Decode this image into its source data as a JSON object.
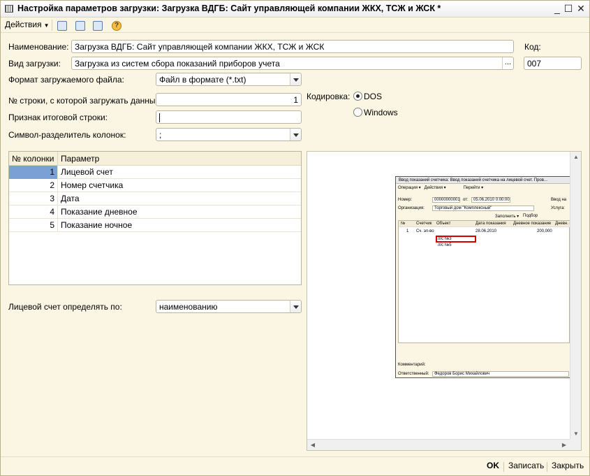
{
  "window": {
    "title": "Настройка параметров загрузки: Загрузка ВДГБ: Сайт управляющей компании ЖКХ, ТСЖ и ЖСК *",
    "minimize": "_",
    "maximize": "☐",
    "close": "✕"
  },
  "toolbar": {
    "actions_label": "Действия",
    "help_glyph": "?"
  },
  "form": {
    "name_label": "Наименование:",
    "name_value": "Загрузка ВДГБ: Сайт управляющей компании ЖКХ, ТСЖ и ЖСК",
    "code_label": "Код:",
    "code_value": "007",
    "load_type_label": "Вид загрузки:",
    "load_type_value": "Загрузка из систем сбора показаний приборов учета",
    "load_type_button": "...",
    "file_format_label": "Формат загружаемого файла:",
    "file_format_value": "Файл в формате (*.txt)",
    "start_row_label": "№ строки, с которой загружать данные:",
    "start_row_value": "1",
    "total_row_label": "Признак итоговой строки:",
    "total_row_value": "",
    "separator_label": "Символ-разделитель колонок:",
    "separator_value": ";",
    "encoding_label": "Кодировка:",
    "encoding_options": [
      "DOS",
      "Windows"
    ],
    "encoding_selected": "DOS",
    "account_by_label": "Лицевой счет определять по:",
    "account_by_value": "наименованию"
  },
  "columns_table": {
    "headers": [
      "№ колонки",
      "Параметр"
    ],
    "rows": [
      {
        "num": "1",
        "param": "Лицевой счет"
      },
      {
        "num": "2",
        "param": "Номер счетчика"
      },
      {
        "num": "3",
        "param": "Дата"
      },
      {
        "num": "4",
        "param": "Показание дневное"
      },
      {
        "num": "5",
        "param": "Показание ночное"
      }
    ],
    "selected_row": 0
  },
  "preview": {
    "title": "Ввод показаний счетчика: Ввод показаний счетчика на лицевой счет. Пров...",
    "menu": [
      "Операция ▾",
      "Действия ▾",
      "Перейти ▾"
    ],
    "number_label": "Номер:",
    "number_value": "00000000001",
    "from_label": "от:",
    "date_value": "05.06.2010 0:00:00",
    "input_label": "Ввод на",
    "org_label": "Организация:",
    "org_value": "Торговый дом \"Комплексный\"",
    "service_label": "Услуга:",
    "fill_label": "Заполнить ▾",
    "select_label": "Подбор",
    "grid_headers": [
      "№",
      "Счетчик",
      "Объект",
      "Дата показания",
      "Дневное показание",
      "Дневн. п"
    ],
    "grid_row": {
      "num": "1",
      "meter": "Сч. эл-во",
      "date": "28.06.2010",
      "value": "200,000"
    },
    "objects": [
      "л/с №3",
      "л/с №5"
    ],
    "comment_label": "Комментарий:",
    "responsible_label": "Ответственный:",
    "responsible_value": "Федоров Борис Михайлович"
  },
  "bottom": {
    "ok": "OK",
    "save": "Записать",
    "close": "Закрыть"
  }
}
